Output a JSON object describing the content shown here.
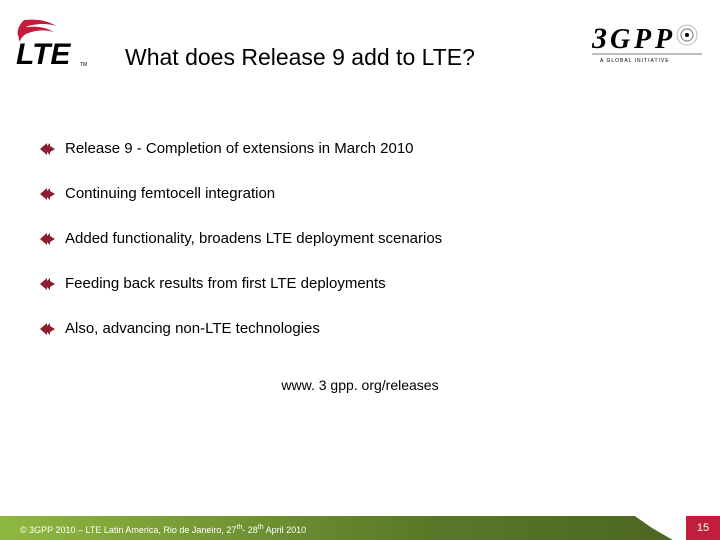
{
  "header": {
    "title": "What does Release 9 add to LTE?",
    "logo_left_name": "lte-logo",
    "logo_right_name": "3gpp-logo",
    "logo_right_tagline": "A GLOBAL INITIATIVE"
  },
  "bullets": [
    "Release 9 - Completion of extensions in March 2010",
    "Continuing femtocell integration",
    "Added functionality, broadens LTE deployment scenarios",
    "Feeding back results from first LTE deployments",
    "Also, advancing non-LTE technologies"
  ],
  "link": "www. 3 gpp. org/releases",
  "footer": {
    "copyright_prefix": "© 3GPP 2010 – LTE Latin America, Rio de Janeiro, 27",
    "ord1": "th",
    "dash": "- 28",
    "ord2": "th",
    "suffix": " April 2010",
    "page": "15"
  }
}
